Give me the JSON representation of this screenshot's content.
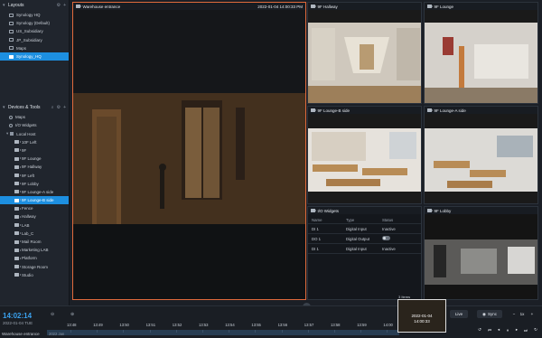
{
  "sidebar": {
    "layouts_title": "Layouts",
    "layouts": [
      {
        "label": "Synology HQ",
        "selected": false
      },
      {
        "label": "Synology (Default)",
        "selected": false
      },
      {
        "label": "US_Subsidiary",
        "selected": false
      },
      {
        "label": "JP_Subsidiary",
        "selected": false
      },
      {
        "label": "Maps",
        "selected": false
      },
      {
        "label": "Synology_HQ",
        "selected": true
      }
    ],
    "devices_title": "Devices & Tools",
    "tools": [
      {
        "label": "Maps"
      },
      {
        "label": "I/O Widgets"
      }
    ],
    "host_label": "Local Host",
    "cameras": [
      {
        "label": "10F Left",
        "selected": false
      },
      {
        "label": "9F",
        "selected": false
      },
      {
        "label": "9F Lounge",
        "selected": false
      },
      {
        "label": "9F Hallway",
        "selected": false
      },
      {
        "label": "9F Left",
        "selected": false
      },
      {
        "label": "9F Lobby",
        "selected": false
      },
      {
        "label": "9F Lounge-A side",
        "selected": false
      },
      {
        "label": "9F Lounge-B side",
        "selected": true
      },
      {
        "label": "Fence",
        "selected": false
      },
      {
        "label": "Hallway",
        "selected": false
      },
      {
        "label": "LAB",
        "selected": false
      },
      {
        "label": "Lab_C",
        "selected": false
      },
      {
        "label": "Mail Room",
        "selected": false
      },
      {
        "label": "Marketing LAB",
        "selected": false
      },
      {
        "label": "Platform",
        "selected": false
      },
      {
        "label": "Storage Room",
        "selected": false
      },
      {
        "label": "Studio",
        "selected": false
      }
    ]
  },
  "main": {
    "main_cam": {
      "name": "Warehouse entrance",
      "timestamp": "2022-01-04 14:00:33 PM"
    },
    "cams": [
      {
        "name": "9F Hallway"
      },
      {
        "name": "9F Lounge"
      },
      {
        "name": "9F Lounge-B side"
      },
      {
        "name": "9F Lounge-A side"
      },
      {
        "name": "9F Lobby"
      }
    ],
    "io": {
      "title": "I/O Widgets",
      "headers": [
        "Name",
        "Type",
        "Status"
      ],
      "rows": [
        {
          "name": "DI 1",
          "type": "Digital Input",
          "status": "Inactive"
        },
        {
          "name": "DO 1",
          "type": "Digital Output",
          "status": ""
        },
        {
          "name": "DI 1",
          "type": "Digital Input",
          "status": "Inactive"
        }
      ]
    }
  },
  "timeline": {
    "current_time": "14:02:14",
    "current_date": "2022-01-04 TUE",
    "ticks": [
      "13:48",
      "13:49",
      "13:50",
      "13:51",
      "13:52",
      "13:53",
      "13:54",
      "13:55",
      "13:56",
      "13:57",
      "13:58",
      "13:59",
      "14:00",
      "14:01",
      "14:02"
    ],
    "camera_label": "Warehouse entrance",
    "camera_sub": "2022 Jan",
    "live_label": "Live",
    "sync_label": "Sync",
    "speed_label": "1x",
    "preview_count": "3 Items",
    "preview_date": "2022-01-04",
    "preview_time": "14:00:33"
  },
  "colors": {
    "accent": "#1d8fe0",
    "active_border": "#e06a3c",
    "time": "#3aa0ec"
  }
}
